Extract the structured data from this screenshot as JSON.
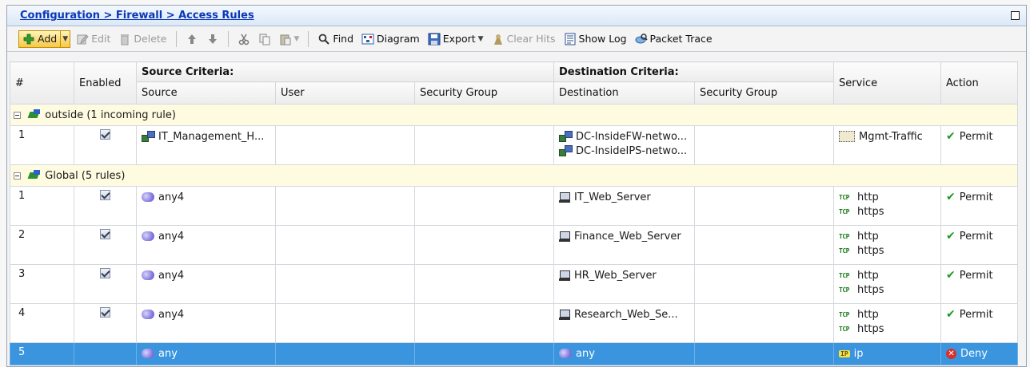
{
  "title_bar": {
    "breadcrumb": "Configuration > Firewall > Access Rules"
  },
  "toolbar": {
    "add": "Add",
    "edit": "Edit",
    "delete": "Delete",
    "find": "Find",
    "diagram": "Diagram",
    "export": "Export",
    "clear_hits": "Clear Hits",
    "show_log": "Show Log",
    "packet_trace": "Packet Trace"
  },
  "table": {
    "headers": {
      "num": "#",
      "enabled": "Enabled",
      "source_criteria": "Source Criteria:",
      "destination_criteria": "Destination Criteria:",
      "source": "Source",
      "user": "User",
      "security_group": "Security Group",
      "destination": "Destination",
      "dest_security_group": "Security Group",
      "service": "Service",
      "action": "Action"
    },
    "groups": [
      {
        "label": "outside (1 incoming rule)",
        "rules": [
          {
            "num": "1",
            "enabled": true,
            "source": "IT_Management_H...",
            "destination": [
              "DC-InsideFW-netwo...",
              "DC-InsideIPS-netwo..."
            ],
            "service": [
              "Mgmt-Traffic"
            ],
            "action": "Permit"
          }
        ]
      },
      {
        "label": "Global (5 rules)",
        "rules": [
          {
            "num": "1",
            "enabled": true,
            "source": "any4",
            "destination": [
              "IT_Web_Server"
            ],
            "service": [
              "http",
              "https"
            ],
            "action": "Permit"
          },
          {
            "num": "2",
            "enabled": true,
            "source": "any4",
            "destination": [
              "Finance_Web_Server"
            ],
            "service": [
              "http",
              "https"
            ],
            "action": "Permit"
          },
          {
            "num": "3",
            "enabled": true,
            "source": "any4",
            "destination": [
              "HR_Web_Server"
            ],
            "service": [
              "http",
              "https"
            ],
            "action": "Permit"
          },
          {
            "num": "4",
            "enabled": true,
            "source": "any4",
            "destination": [
              "Research_Web_Se..."
            ],
            "service": [
              "http",
              "https"
            ],
            "action": "Permit"
          },
          {
            "num": "5",
            "enabled": false,
            "source": "any",
            "destination": [
              "any"
            ],
            "service": [
              "ip"
            ],
            "action": "Deny",
            "selected": true
          }
        ]
      }
    ]
  },
  "tags": {
    "tcp": "TCP",
    "ip": "IP"
  },
  "colors": {
    "selection": "#3a95de",
    "group_row": "#fffbe1",
    "breadcrumb": "#0b37b8",
    "permit": "#1c9a24",
    "deny": "#d8312b"
  }
}
